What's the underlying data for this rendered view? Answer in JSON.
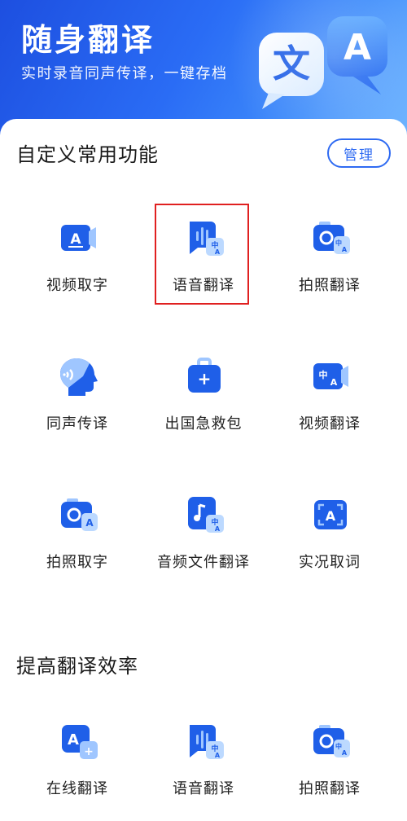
{
  "hero": {
    "title": "随身翻译",
    "subtitle": "实时录音同声传译，一键存档",
    "art_letters": {
      "left": "文",
      "right": "A"
    }
  },
  "custom_section": {
    "title": "自定义常用功能",
    "manage_label": "管理",
    "items": [
      {
        "label": "视频取字",
        "icon": "video-text-icon"
      },
      {
        "label": "语音翻译",
        "icon": "voice-translate-icon",
        "highlighted": true
      },
      {
        "label": "拍照翻译",
        "icon": "camera-translate-icon"
      },
      {
        "label": "同声传译",
        "icon": "simultaneous-interpret-icon"
      },
      {
        "label": "出国急救包",
        "icon": "first-aid-kit-icon"
      },
      {
        "label": "视频翻译",
        "icon": "video-translate-icon"
      },
      {
        "label": "拍照取字",
        "icon": "camera-text-icon"
      },
      {
        "label": "音频文件翻译",
        "icon": "audio-file-translate-icon"
      },
      {
        "label": "实况取词",
        "icon": "live-scan-icon"
      }
    ]
  },
  "efficiency_section": {
    "title": "提高翻译效率",
    "items": [
      {
        "label": "在线翻译",
        "icon": "online-translate-icon"
      },
      {
        "label": "语音翻译",
        "icon": "voice-translate-icon"
      },
      {
        "label": "拍照翻译",
        "icon": "camera-translate-icon"
      }
    ]
  },
  "icon_glyphs": {
    "zh": "中",
    "a": "A",
    "plus": "+"
  },
  "colors": {
    "accent": "#2f6bf2",
    "icon_dark": "#1f5fe8",
    "icon_light": "#9fc6ff",
    "highlight": "#e02020"
  }
}
